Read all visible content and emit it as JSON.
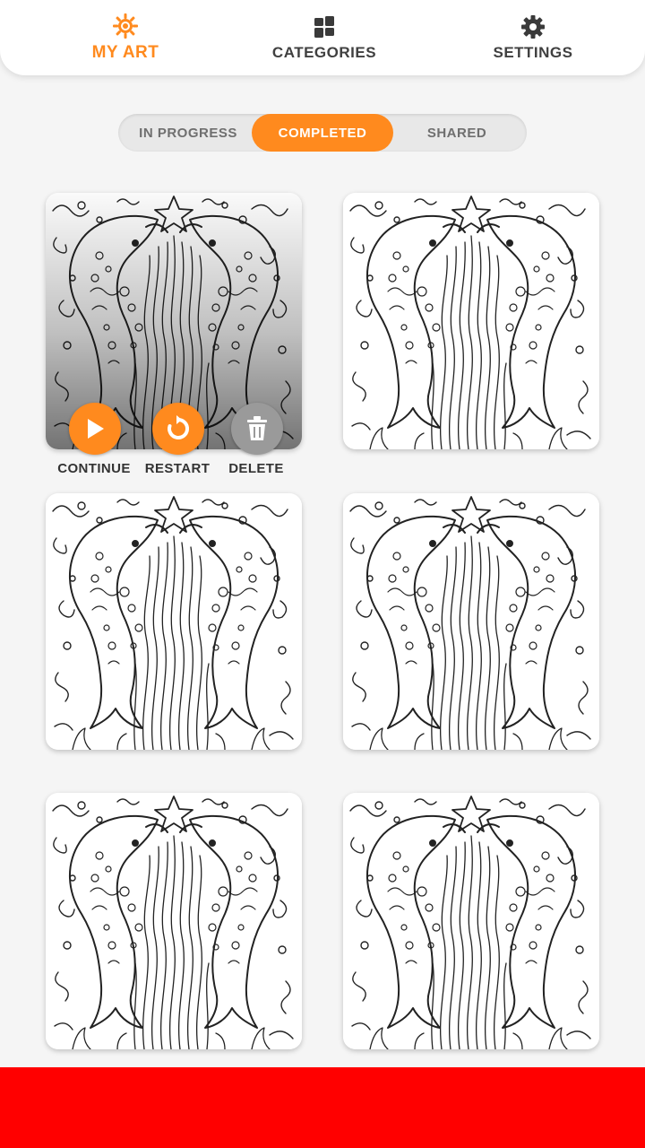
{
  "nav": {
    "my_art": {
      "label": "MY ART",
      "icon": "sun-gear-icon",
      "active": true
    },
    "categories": {
      "label": "CATEGORIES",
      "icon": "grid-icon"
    },
    "settings": {
      "label": "SETTINGS",
      "icon": "gear-icon"
    }
  },
  "tabs": [
    {
      "label": "IN PROGRESS",
      "active": false
    },
    {
      "label": "COMPLETED",
      "active": true
    },
    {
      "label": "SHARED",
      "active": false
    }
  ],
  "card_actions": {
    "continue_label": "CONTINUE",
    "restart_label": "RESTART",
    "delete_label": "DELETE"
  },
  "gallery": {
    "artwork_icon": "dolphins-coloring-page",
    "count": 6
  },
  "colors": {
    "accent": "#ff8a1e",
    "banner": "#ff0000",
    "background": "#f5f5f5",
    "delete_button": "#9a9a9a"
  }
}
